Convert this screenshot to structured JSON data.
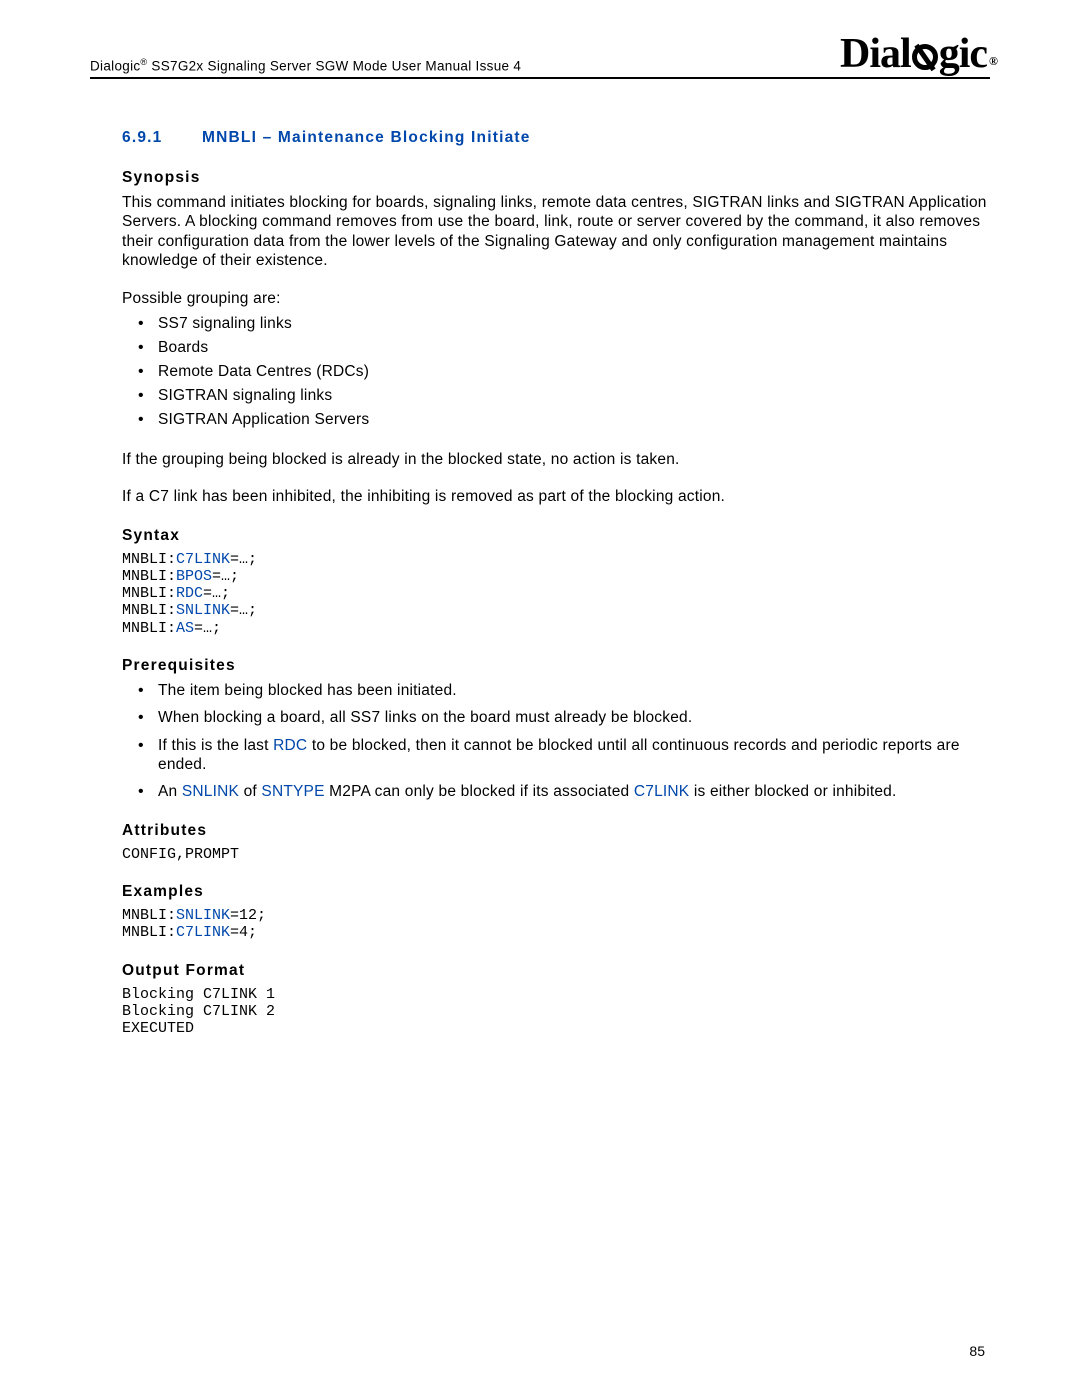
{
  "header": {
    "product_prefix": "Dialogic",
    "product_suffix": " SS7G2x Signaling Server SGW Mode User Manual Issue 4",
    "logo": "Dialogic"
  },
  "section": {
    "number": "6.9.1",
    "title": "MNBLI – Maintenance Blocking Initiate"
  },
  "synopsis": {
    "heading": "Synopsis",
    "para1": "This command initiates blocking for boards, signaling links, remote data centres, SIGTRAN links and SIGTRAN Application Servers. A blocking command removes from use the board, link, route or server covered by the command, it also removes their configuration data from the lower levels of the Signaling Gateway and only configuration management maintains knowledge of their existence.",
    "para2": "Possible grouping are:",
    "bullets": [
      "SS7 signaling links",
      "Boards",
      "Remote Data Centres (RDCs)",
      "SIGTRAN signaling links",
      "SIGTRAN Application Servers"
    ],
    "para3": "If the grouping being blocked is already in the blocked state, no action is taken.",
    "para4": "If a C7 link has been inhibited, the inhibiting is removed as part of the blocking action."
  },
  "syntax": {
    "heading": "Syntax",
    "lines": [
      {
        "cmd": "MNBLI:",
        "kw": "C7LINK",
        "tail": "=…;"
      },
      {
        "cmd": "MNBLI:",
        "kw": "BPOS",
        "tail": "=…;"
      },
      {
        "cmd": "MNBLI:",
        "kw": "RDC",
        "tail": "=…;"
      },
      {
        "cmd": "MNBLI:",
        "kw": "SNLINK",
        "tail": "=…;"
      },
      {
        "cmd": "MNBLI:",
        "kw": "AS",
        "tail": "=…;"
      }
    ]
  },
  "prereq": {
    "heading": "Prerequisites",
    "items": {
      "p1": "The item being blocked has been initiated.",
      "p2": "When blocking a board, all SS7 links on the board must already be blocked.",
      "p3a": "If this is the last ",
      "p3kw": "RDC",
      "p3b": " to be blocked, then it cannot be blocked until all continuous records and periodic reports are ended.",
      "p4a": "An ",
      "p4kw1": "SNLINK",
      "p4b": " of ",
      "p4kw2": "SNTYPE",
      "p4c": " M2PA can only be blocked if its associated ",
      "p4kw3": "C7LINK",
      "p4d": " is either blocked or inhibited."
    }
  },
  "attributes": {
    "heading": "Attributes",
    "value": "CONFIG,PROMPT"
  },
  "examples": {
    "heading": "Examples",
    "lines": [
      {
        "cmd": "MNBLI:",
        "kw": "SNLINK",
        "tail": "=12;"
      },
      {
        "cmd": "MNBLI:",
        "kw": "C7LINK",
        "tail": "=4;"
      }
    ]
  },
  "output": {
    "heading": "Output Format",
    "text": "Blocking C7LINK 1\nBlocking C7LINK 2\nEXECUTED"
  },
  "page_number": "85"
}
